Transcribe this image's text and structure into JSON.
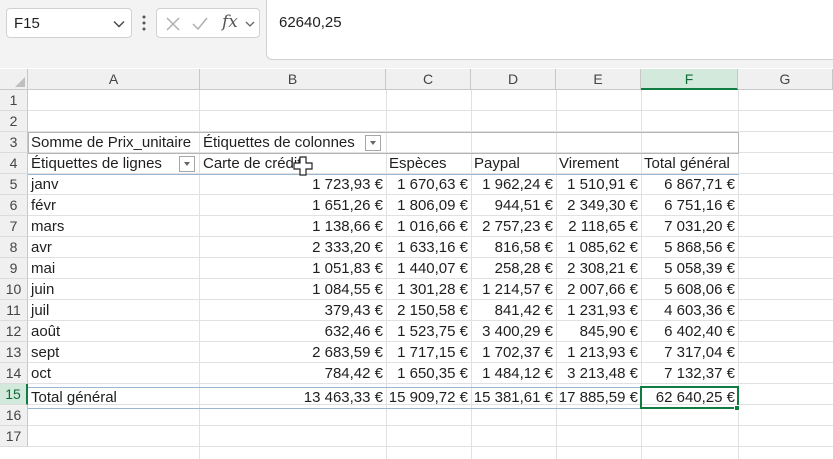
{
  "formula_bar": {
    "name_box": "F15",
    "fx_label": "fx",
    "formula_value": "62640,25"
  },
  "columns": [
    "A",
    "B",
    "C",
    "D",
    "E",
    "F",
    "G"
  ],
  "selected_column": "F",
  "rows": [
    "1",
    "2",
    "3",
    "4",
    "5",
    "6",
    "7",
    "8",
    "9",
    "10",
    "11",
    "12",
    "13",
    "14",
    "15",
    "16",
    "17"
  ],
  "selected_row": "15",
  "pivot": {
    "values_label": "Somme de Prix_unitaire",
    "col_labels_header": "Étiquettes de colonnes",
    "row_labels_header": "Étiquettes de lignes",
    "column_headers": [
      "Carte de crédit",
      "Espèces",
      "Paypal",
      "Virement",
      "Total général"
    ],
    "data_rows": [
      {
        "label": "janv",
        "values": [
          "1 723,93 €",
          "1 670,63 €",
          "1 962,24 €",
          "1 510,91 €",
          "6 867,71 €"
        ]
      },
      {
        "label": "févr",
        "values": [
          "1 651,26 €",
          "1 806,09 €",
          "944,51 €",
          "2 349,30 €",
          "6 751,16 €"
        ]
      },
      {
        "label": "mars",
        "values": [
          "1 138,66 €",
          "1 016,66 €",
          "2 757,23 €",
          "2 118,65 €",
          "7 031,20 €"
        ]
      },
      {
        "label": "avr",
        "values": [
          "2 333,20 €",
          "1 633,16 €",
          "816,58 €",
          "1 085,62 €",
          "5 868,56 €"
        ]
      },
      {
        "label": "mai",
        "values": [
          "1 051,83 €",
          "1 440,07 €",
          "258,28 €",
          "2 308,21 €",
          "5 058,39 €"
        ]
      },
      {
        "label": "juin",
        "values": [
          "1 084,55 €",
          "1 301,28 €",
          "1 214,57 €",
          "2 007,66 €",
          "5 608,06 €"
        ]
      },
      {
        "label": "juil",
        "values": [
          "379,43 €",
          "2 150,58 €",
          "841,42 €",
          "1 231,93 €",
          "4 603,36 €"
        ]
      },
      {
        "label": "août",
        "values": [
          "632,46 €",
          "1 523,75 €",
          "3 400,29 €",
          "845,90 €",
          "6 402,40 €"
        ]
      },
      {
        "label": "sept",
        "values": [
          "2 683,59 €",
          "1 717,15 €",
          "1 702,37 €",
          "1 213,93 €",
          "7 317,04 €"
        ]
      },
      {
        "label": "oct",
        "values": [
          "784,42 €",
          "1 650,35 €",
          "1 484,12 €",
          "3 213,48 €",
          "7 132,37 €"
        ]
      }
    ],
    "total_row": {
      "label": "Total général",
      "values": [
        "13 463,33 €",
        "15 909,72 €",
        "15 381,61 €",
        "17 885,59 €",
        "62 640,25 €"
      ]
    }
  },
  "colors": {
    "accent": "#107c41",
    "header_bg": "#f0f0f0",
    "selected_header_bg": "#d2e9dc"
  }
}
